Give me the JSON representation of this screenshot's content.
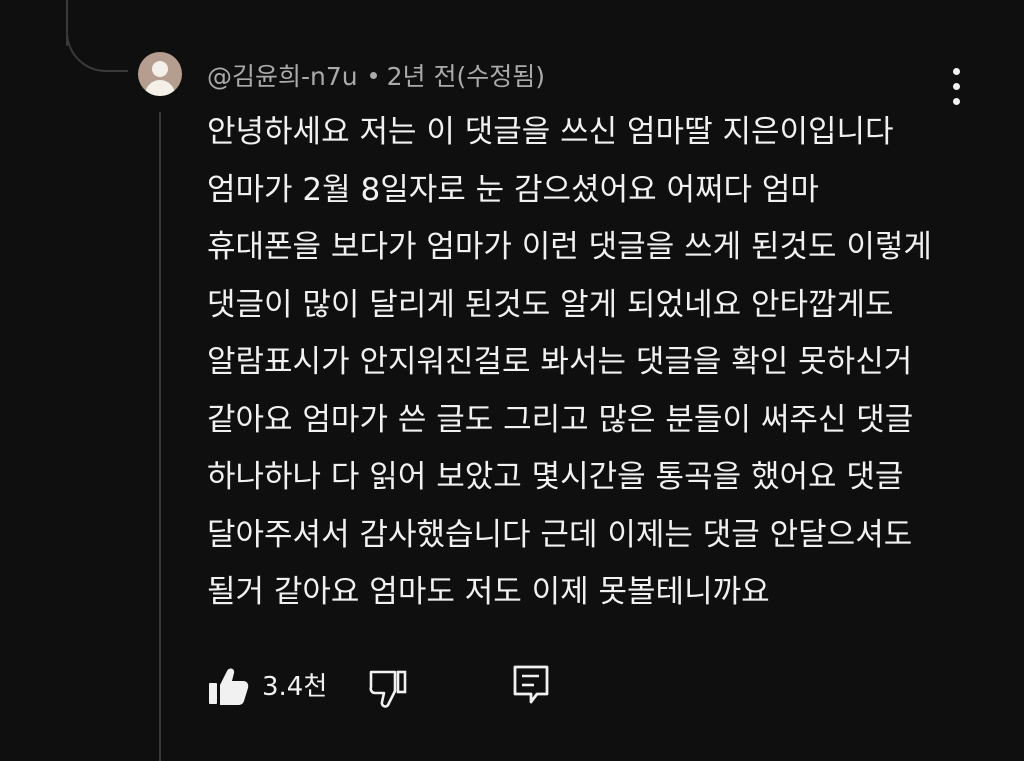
{
  "comment": {
    "author": "@김윤희-n7u",
    "timestamp": "2년 전(수정됨)",
    "lines": [
      "안녕하세요 저는 이 댓글을 쓰신 엄마딸 지은이입니다",
      "엄마가 2월 8일자로 눈 감으셨어요 어쩌다 엄마",
      "휴대폰을 보다가 엄마가 이런 댓글을 쓰게 된것도 이렇게",
      "댓글이 많이 달리게 된것도 알게 되었네요 안타깝게도",
      "알람표시가 안지워진걸로 봐서는 댓글을 확인 못하신거",
      "같아요 엄마가 쓴 글도 그리고 많은 분들이 써주신 댓글",
      "하나하나 다 읽어 보았고 몇시간을 통곡을 했어요 댓글",
      "달아주셔서 감사했습니다 근데 이제는 댓글 안달으셔도",
      "될거 같아요 엄마도 저도 이제 못볼테니까요"
    ]
  },
  "actions": {
    "like_count": "3.4천",
    "icons": [
      "thumbs-up-icon",
      "thumbs-down-icon",
      "reply-icon",
      "more-vert-icon"
    ]
  },
  "colors": {
    "background": "#0f0f0f",
    "text": "#f1f1f1",
    "meta_text": "#aaaaaa",
    "thread_line": "#3a3a3a",
    "avatar": "#b59e8f"
  }
}
